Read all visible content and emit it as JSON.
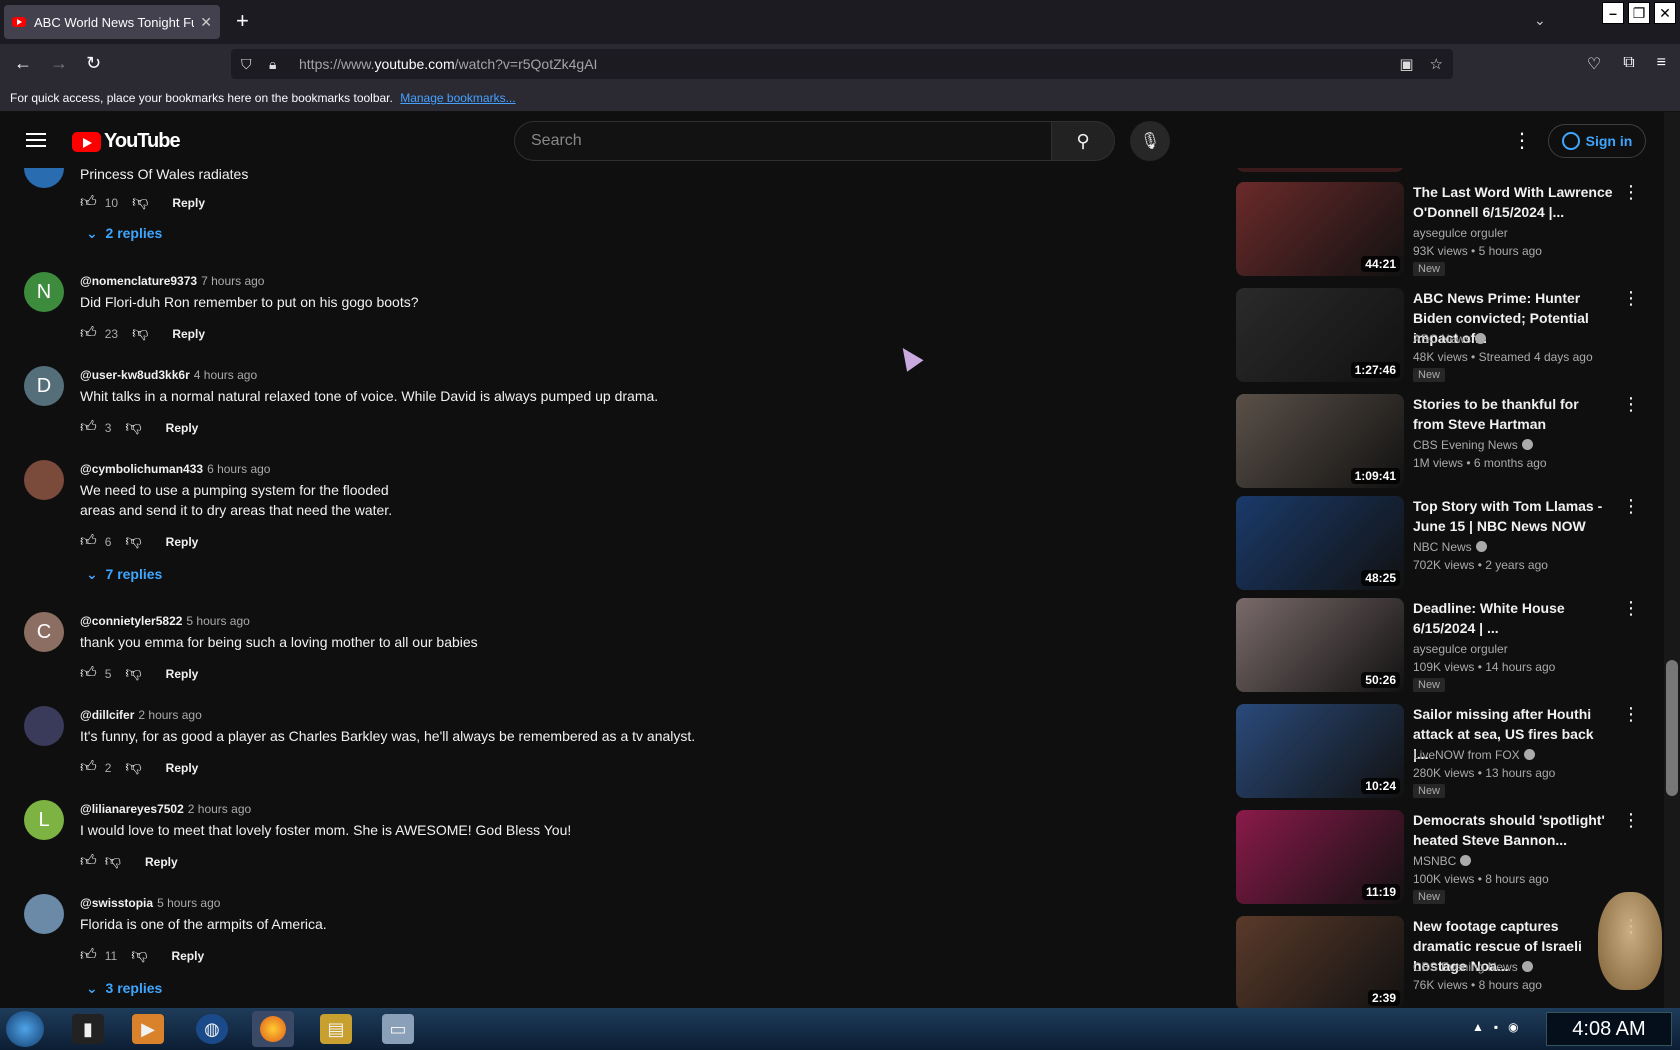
{
  "browser": {
    "tab_title": "ABC World News Tonight Full E",
    "url_prefix": "https://www.",
    "url_domain": "youtube.com",
    "url_path": "/watch?v=r5QotZk4gAI",
    "bookmarks_text": "For quick access, place your bookmarks here on the bookmarks toolbar.",
    "bookmarks_link": "Manage bookmarks..."
  },
  "youtube": {
    "logo": "YouTube",
    "search_placeholder": "Search",
    "sign_in": "Sign in"
  },
  "comments": [
    {
      "user": "",
      "time": "",
      "text": "Princess Of Wales radiates",
      "likes": "10",
      "reply": "Reply",
      "replies": "2 replies",
      "avatar_letter": "",
      "avatar_color": "#2a6cb0"
    },
    {
      "user": "@nomenclature9373",
      "time": "7 hours ago",
      "text": "Did Flori-duh Ron remember to put on his gogo boots?",
      "likes": "23",
      "reply": "Reply",
      "avatar_letter": "N",
      "avatar_color": "#3d8b3d"
    },
    {
      "user": "@user-kw8ud3kk6r",
      "time": "4 hours ago",
      "text": "Whit talks in a normal natural relaxed tone of voice. While David is always pumped up drama.",
      "likes": "3",
      "reply": "Reply",
      "avatar_letter": "D",
      "avatar_color": "#546e7a"
    },
    {
      "user": "@cymbolichuman433",
      "time": "6 hours ago",
      "text_line1": "We need to use a pumping system for the flooded",
      "text_line2": "areas and send it to dry areas that need the water.",
      "likes": "6",
      "reply": "Reply",
      "replies": "7 replies",
      "avatar_letter": "",
      "avatar_color": "#7a4a3a"
    },
    {
      "user": "@connietyler5822",
      "time": "5 hours ago",
      "text": "thank you emma for being such a loving mother to all our babies",
      "likes": "5",
      "reply": "Reply",
      "avatar_letter": "C",
      "avatar_color": "#8d6e63"
    },
    {
      "user": "@dillcifer",
      "time": "2 hours ago",
      "text": "It's funny, for as good a player as Charles Barkley was, he'll always be remembered as a tv analyst.",
      "likes": "2",
      "reply": "Reply",
      "avatar_letter": "",
      "avatar_color": "#3a3a5a"
    },
    {
      "user": "@lilianareyes7502",
      "time": "2 hours ago",
      "text": "I would love to meet that lovely foster mom. She is AWESOME!  God Bless You!",
      "likes": "",
      "reply": "Reply",
      "avatar_letter": "L",
      "avatar_color": "#7cb342"
    },
    {
      "user": "@swisstopia",
      "time": "5 hours ago",
      "text": "Florida is one of the armpits of America.",
      "likes": "11",
      "reply": "Reply",
      "replies": "3 replies",
      "avatar_letter": "",
      "avatar_color": "#6a8aa8"
    }
  ],
  "videos": [
    {
      "title": "The Last Word With Lawrence O'Donnell 6/15/2024 |...",
      "channel": "aysegulce orguler",
      "views": "93K views",
      "age": "5 hours ago",
      "duration": "44:21",
      "new": "New",
      "verified": false,
      "color": "#6b2a2a"
    },
    {
      "title": "ABC News Prime: Hunter Biden convicted; Potential impact of...",
      "channel": "ABC News",
      "views": "48K views",
      "age": "Streamed 4 days ago",
      "duration": "1:27:46",
      "new": "New",
      "verified": true,
      "color": "#2a2a2a"
    },
    {
      "title": "Stories to be thankful for from Steve Hartman",
      "channel": "CBS Evening News",
      "views": "1M views",
      "age": "6 months ago",
      "duration": "1:09:41",
      "new": "",
      "verified": true,
      "color": "#5a5048"
    },
    {
      "title": "Top Story with Tom Llamas - June 15 | NBC News NOW",
      "channel": "NBC News",
      "views": "702K views",
      "age": "2 years ago",
      "duration": "48:25",
      "new": "",
      "verified": true,
      "color": "#1a3a6a"
    },
    {
      "title": "Deadline: White House 6/15/2024 | ...",
      "channel": "aysegulce orguler",
      "views": "109K views",
      "age": "14 hours ago",
      "duration": "50:26",
      "new": "New",
      "verified": false,
      "color": "#7a6a6a"
    },
    {
      "title": "Sailor missing after Houthi attack at sea, US fires back |...",
      "channel": "LiveNOW from FOX",
      "views": "280K views",
      "age": "13 hours ago",
      "duration": "10:24",
      "new": "New",
      "verified": true,
      "color": "#2a4a7a"
    },
    {
      "title": "Democrats should 'spotlight' heated Steve Bannon...",
      "channel": "MSNBC",
      "views": "100K views",
      "age": "8 hours ago",
      "duration": "11:19",
      "new": "New",
      "verified": true,
      "color": "#8a1a4a"
    },
    {
      "title": "New footage captures dramatic rescue of Israeli hostage Noa...",
      "channel": "CBS Evening News",
      "views": "76K views",
      "age": "8 hours ago",
      "duration": "2:39",
      "new": "",
      "verified": true,
      "color": "#5a3a2a"
    }
  ],
  "taskbar": {
    "clock": "4:08 AM"
  }
}
